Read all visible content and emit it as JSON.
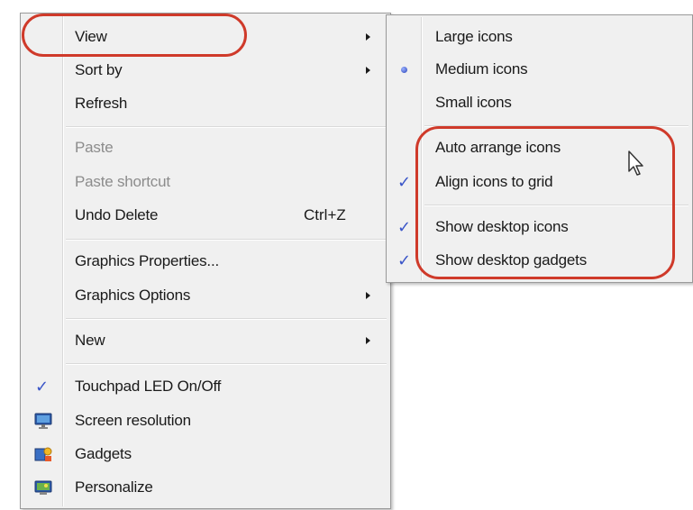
{
  "context_menu": {
    "items": [
      {
        "label": "View",
        "has_submenu": true
      },
      {
        "label": "Sort by",
        "has_submenu": true
      },
      {
        "label": "Refresh"
      },
      {
        "label": "Paste",
        "disabled": true
      },
      {
        "label": "Paste shortcut",
        "disabled": true
      },
      {
        "label": "Undo Delete",
        "shortcut": "Ctrl+Z"
      },
      {
        "label": "Graphics Properties..."
      },
      {
        "label": "Graphics Options",
        "has_submenu": true
      },
      {
        "label": "New",
        "has_submenu": true
      },
      {
        "label": "Touchpad LED On/Off",
        "checked": true
      },
      {
        "label": "Screen resolution",
        "icon": "screen-resolution-icon"
      },
      {
        "label": "Gadgets",
        "icon": "gadgets-icon"
      },
      {
        "label": "Personalize",
        "icon": "personalize-icon"
      }
    ]
  },
  "view_submenu": {
    "items": [
      {
        "label": "Large icons"
      },
      {
        "label": "Medium icons",
        "selected": true
      },
      {
        "label": "Small icons"
      },
      {
        "label": "Auto arrange icons",
        "hovered": true
      },
      {
        "label": "Align icons to grid",
        "checked": true
      },
      {
        "label": "Show desktop icons",
        "checked": true
      },
      {
        "label": "Show desktop gadgets",
        "checked": true
      }
    ]
  },
  "glyphs": {
    "check": "✓"
  },
  "colors": {
    "menu_background": "#f0f0f0",
    "annotation": "#cf3a2a",
    "check_mark": "#3a55c8"
  }
}
